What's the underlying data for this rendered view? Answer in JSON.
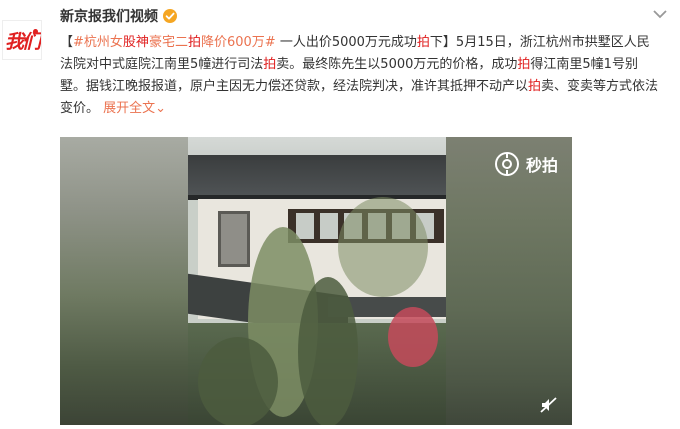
{
  "account": {
    "avatar_text": "我们",
    "username": "新京报我们视频"
  },
  "post": {
    "topic": "#杭州女股神豪宅二拍降价600万#",
    "topic_parts": [
      "#杭州女",
      "股神",
      "豪宅二",
      "拍",
      "降价600万#"
    ],
    "text_1": " 一人出价5000万元成功",
    "hl_1": "拍",
    "text_2": "下】5月15日，浙江杭州市拱墅区人民法院对中式庭院江南里5幢进行司法",
    "hl_2": "拍",
    "text_3": "卖。最终陈先生以5000万元的价格，成功",
    "hl_3": "拍",
    "text_4": "得江南里5幢1号别墅。据钱江晚报报道，原户主因无力偿还贷款，经法院判决，准许其抵押不动产以",
    "hl_4": "拍",
    "text_5": "卖、变卖等方式依法变价。",
    "bracket_open": "【",
    "expand_link": "展开全文",
    "expand_arrow": "⌄"
  },
  "video": {
    "watermark": "秒拍"
  },
  "colors": {
    "topic": "#eb7350",
    "highlight": "#e02020",
    "verified": "#f5a623"
  },
  "icons": [
    "verified-icon",
    "chevron-down-icon",
    "miaopai-logo-icon",
    "mute-icon"
  ]
}
